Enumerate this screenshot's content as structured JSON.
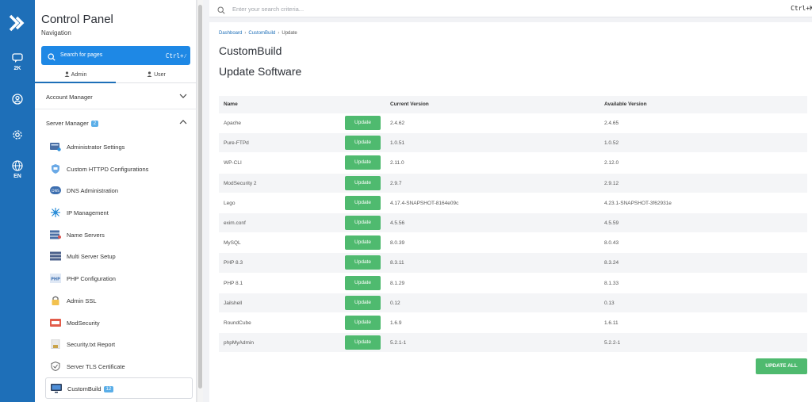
{
  "rail": {
    "items": [
      {
        "icon": "chat-icon",
        "label": "2K"
      },
      {
        "icon": "user-circle-icon",
        "label": ""
      },
      {
        "icon": "gear-icon",
        "label": ""
      },
      {
        "icon": "globe-icon",
        "label": "EN"
      }
    ]
  },
  "sidebar": {
    "title": "Control Panel",
    "subtitle": "Navigation",
    "search_label": "Search for pages",
    "search_shortcut": "Ctrl+⁄",
    "tabs": [
      {
        "label": "Admin",
        "active": true
      },
      {
        "label": "User",
        "active": false
      }
    ],
    "account_manager": "Account Manager",
    "server_manager": "Server Manager",
    "server_manager_badge": "2",
    "items": [
      {
        "label": "Administrator Settings",
        "icon": "admin-settings-icon"
      },
      {
        "label": "Custom HTTPD Configurations",
        "icon": "httpd-icon"
      },
      {
        "label": "DNS Administration",
        "icon": "dns-icon"
      },
      {
        "label": "IP Management",
        "icon": "ip-icon"
      },
      {
        "label": "Name Servers",
        "icon": "name-servers-icon"
      },
      {
        "label": "Multi Server Setup",
        "icon": "multi-server-icon"
      },
      {
        "label": "PHP Configuration",
        "icon": "php-icon"
      },
      {
        "label": "Admin SSL",
        "icon": "lock-icon"
      },
      {
        "label": "ModSecurity",
        "icon": "modsecurity-icon"
      },
      {
        "label": "Security.txt Report",
        "icon": "report-icon"
      },
      {
        "label": "Server TLS Certificate",
        "icon": "shield-icon"
      },
      {
        "label": "CustomBuild",
        "icon": "custombuild-icon",
        "badge": "12",
        "active": true
      }
    ]
  },
  "topbar": {
    "placeholder": "Enter your search criteria...",
    "shortcut": "Ctrl+K"
  },
  "main": {
    "breadcrumb": [
      "Dashboard",
      "CustomBuild",
      "Update"
    ],
    "title": "CustomBuild",
    "subtitle": "Update Software",
    "columns": [
      "Name",
      "Current Version",
      "Available Version"
    ],
    "update_label": "Update",
    "rows": [
      {
        "name": "Apache",
        "current": "2.4.62",
        "available": "2.4.65"
      },
      {
        "name": "Pure-FTPd",
        "current": "1.0.51",
        "available": "1.0.52"
      },
      {
        "name": "WP-CLI",
        "current": "2.11.0",
        "available": "2.12.0"
      },
      {
        "name": "ModSecurity 2",
        "current": "2.9.7",
        "available": "2.9.12"
      },
      {
        "name": "Lego",
        "current": "4.17.4-SNAPSHOT-8164e09c",
        "available": "4.23.1-SNAPSHOT-3f62931e"
      },
      {
        "name": "exim.conf",
        "current": "4.5.56",
        "available": "4.5.59"
      },
      {
        "name": "MySQL",
        "current": "8.0.39",
        "available": "8.0.43"
      },
      {
        "name": "PHP 8.3",
        "current": "8.3.11",
        "available": "8.3.24"
      },
      {
        "name": "PHP 8.1",
        "current": "8.1.29",
        "available": "8.1.33"
      },
      {
        "name": "Jailshell",
        "current": "0.12",
        "available": "0.13"
      },
      {
        "name": "RoundCube",
        "current": "1.6.9",
        "available": "1.6.11"
      },
      {
        "name": "phpMyAdmin",
        "current": "5.2.1-1",
        "available": "5.2.2-1"
      }
    ],
    "update_all_label": "UPDATE ALL"
  },
  "colors": {
    "rail": "#1e6fb8",
    "accent": "#1e88e5",
    "success": "#4fba6f",
    "badge": "#5aaee8"
  }
}
